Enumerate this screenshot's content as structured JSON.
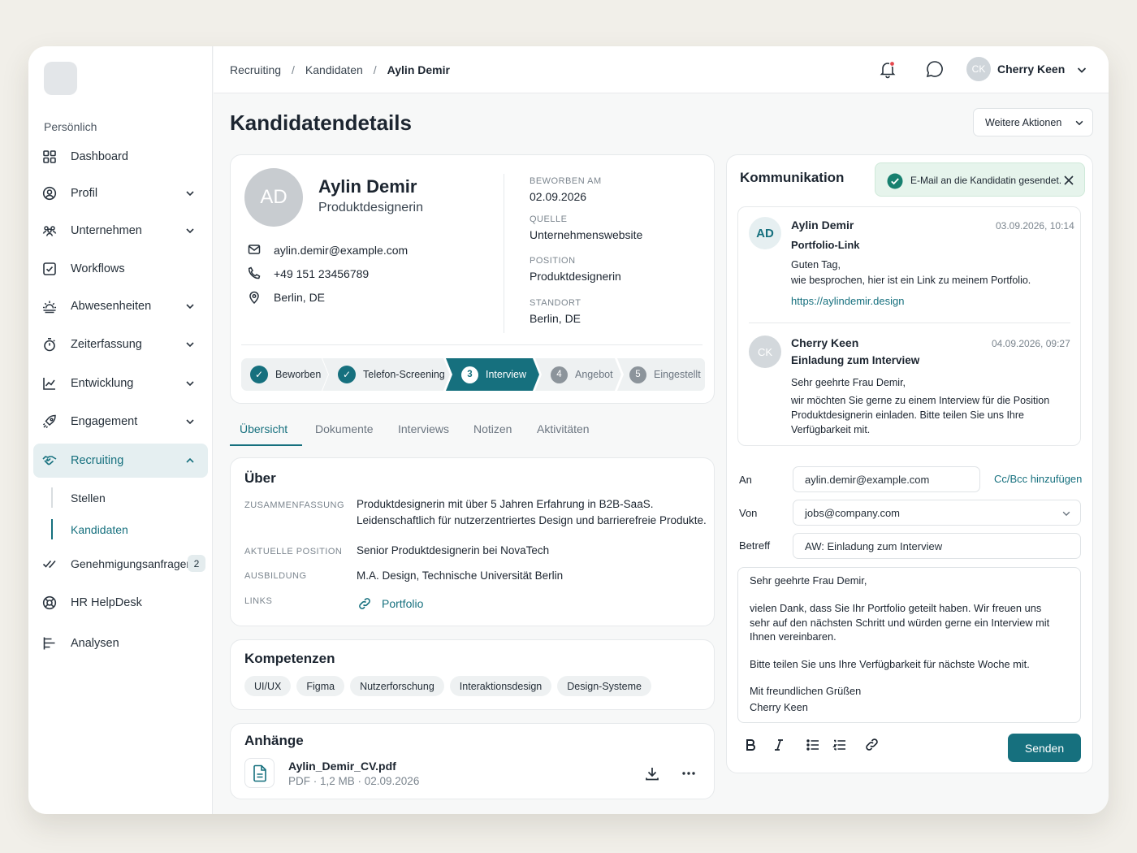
{
  "sidebar": {
    "section": "Persönlich",
    "items": [
      {
        "label": "Dashboard"
      },
      {
        "label": "Profil"
      },
      {
        "label": "Unternehmen"
      },
      {
        "label": "Workflows"
      },
      {
        "label": "Abwesenheiten"
      },
      {
        "label": "Zeiterfassung"
      },
      {
        "label": "Entwicklung"
      },
      {
        "label": "Engagement"
      },
      {
        "label": "Recruiting"
      },
      {
        "label": "Genehmigungsanfragen",
        "badge": "2"
      },
      {
        "label": "HR HelpDesk"
      },
      {
        "label": "Analysen"
      }
    ],
    "sub": [
      {
        "label": "Stellen"
      },
      {
        "label": "Kandidaten"
      }
    ]
  },
  "topbar": {
    "breadcrumb": [
      "Recruiting",
      "/",
      "Kandidaten",
      "/",
      "Aylin Demir"
    ],
    "user": {
      "initials": "CK",
      "name": "Cherry Keen"
    }
  },
  "page": {
    "title": "Kandidatendetails",
    "more_actions": "Weitere Aktionen"
  },
  "candidate": {
    "initials": "AD",
    "name": "Aylin Demir",
    "role": "Produktdesignerin",
    "email": "aylin.demir@example.com",
    "phone": "+49 151 23456789",
    "location": "Berlin, DE",
    "meta": [
      {
        "label": "Beworben am",
        "value": "02.09.2026"
      },
      {
        "label": "Quelle",
        "value": "Unternehmenswebsite"
      },
      {
        "label": "Position",
        "value": "Produktdesignerin"
      },
      {
        "label": "Standort",
        "value": "Berlin, DE"
      }
    ],
    "steps": [
      {
        "label": "Beworben",
        "marker": "✓"
      },
      {
        "label": "Telefon-Screening",
        "marker": "✓"
      },
      {
        "label": "Interview",
        "marker": "3"
      },
      {
        "label": "Angebot",
        "marker": "4"
      },
      {
        "label": "Eingestellt",
        "marker": "5"
      }
    ]
  },
  "tabs": [
    "Übersicht",
    "Dokumente",
    "Interviews",
    "Notizen",
    "Aktivitäten"
  ],
  "about": {
    "title": "Über",
    "summary_label": "Zusammenfassung",
    "summary": [
      "Produktdesignerin mit über 5 Jahren Erfahrung in B2B-SaaS.",
      "Leidenschaftlich für nutzerzentriertes Design und barrierefreie Produkte."
    ],
    "position_label": "Aktuelle Position",
    "position": "Senior Produktdesignerin bei NovaTech",
    "education_label": "Ausbildung",
    "education": "M.A. Design, Technische Universität Berlin",
    "links_label": "Links",
    "link": "Portfolio"
  },
  "skills": {
    "title": "Kompetenzen",
    "items": [
      "UI/UX",
      "Figma",
      "Nutzerforschung",
      "Interaktionsdesign",
      "Design-Systeme"
    ]
  },
  "attachments": {
    "title": "Anhänge",
    "file": {
      "name": "Aylin_Demir_CV.pdf",
      "meta": "PDF · 1,2 MB · 02.09.2026"
    }
  },
  "comm": {
    "title": "Kommunikation",
    "toast": "E-Mail an die Kandidatin gesendet.",
    "messages": [
      {
        "initials": "AD",
        "sender": "Aylin Demir",
        "date": "03.09.2026, 10:14",
        "subject": "Portfolio-Link",
        "lines": [
          "Guten Tag,",
          "wie besprochen, hier ist ein Link zu meinem Portfolio."
        ],
        "link": "https://aylindemir.design"
      },
      {
        "initials": "CK",
        "sender": "Cherry Keen",
        "date": "04.09.2026, 09:27",
        "subject": "Einladung zum Interview",
        "lines": [
          "Sehr geehrte Frau Demir,",
          "wir möchten Sie gerne zu einem Interview für die Position",
          "Produktdesignerin einladen. Bitte teilen Sie uns Ihre",
          "Verfügbarkeit mit."
        ]
      }
    ],
    "compose": {
      "to_label": "An",
      "to": "aylin.demir@example.com",
      "ccbcc": "Cc/Bcc hinzufügen",
      "from_label": "Von",
      "from": "jobs@company.com",
      "subject_label": "Betreff",
      "subject": "AW: Einladung zum Interview",
      "body": [
        "Sehr geehrte Frau Demir,",
        "vielen Dank, dass Sie Ihr Portfolio geteilt haben. Wir freuen uns",
        "sehr auf den nächsten Schritt und würden gerne ein Interview mit",
        "Ihnen vereinbaren.",
        "Bitte teilen Sie uns Ihre Verfügbarkeit für nächste Woche mit.",
        "Mit freundlichen Grüßen",
        "Cherry Keen"
      ],
      "send": "Senden"
    }
  },
  "colors": {
    "accent": "#16707e",
    "toast_bg": "#e6f4ec",
    "toast_icon": "#17806f"
  }
}
